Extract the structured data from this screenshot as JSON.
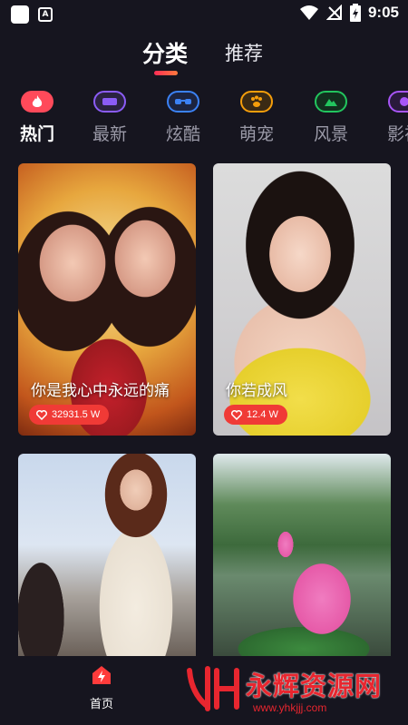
{
  "status_bar": {
    "time": "9:05"
  },
  "top_tabs": {
    "active": "分类",
    "inactive": "推荐"
  },
  "categories": [
    {
      "label": "热门",
      "icon": "flame-icon",
      "color": "#ff4a5a"
    },
    {
      "label": "最新",
      "icon": "new-icon",
      "color": "#8b5cf6"
    },
    {
      "label": "炫酷",
      "icon": "sunglasses-icon",
      "color": "#3b82f6"
    },
    {
      "label": "萌宠",
      "icon": "paw-icon",
      "color": "#f59e0b"
    },
    {
      "label": "风景",
      "icon": "mountain-icon",
      "color": "#22c55e"
    },
    {
      "label": "影视",
      "icon": "film-icon",
      "color": "#a855f7"
    }
  ],
  "cards": [
    {
      "title": "你是我心中永远的痛",
      "likes": "32931.5 W"
    },
    {
      "title": "你若成风",
      "likes": "12.4 W"
    },
    {
      "title": "",
      "likes": ""
    },
    {
      "title": "",
      "likes": ""
    }
  ],
  "bottom_nav": {
    "home_label": "首页"
  },
  "watermark": {
    "text": "永辉资源网",
    "url": "www.yhkjjj.com"
  },
  "colors": {
    "accent": "#ff2d55",
    "badge": "#f03a36",
    "background": "#16151f"
  }
}
